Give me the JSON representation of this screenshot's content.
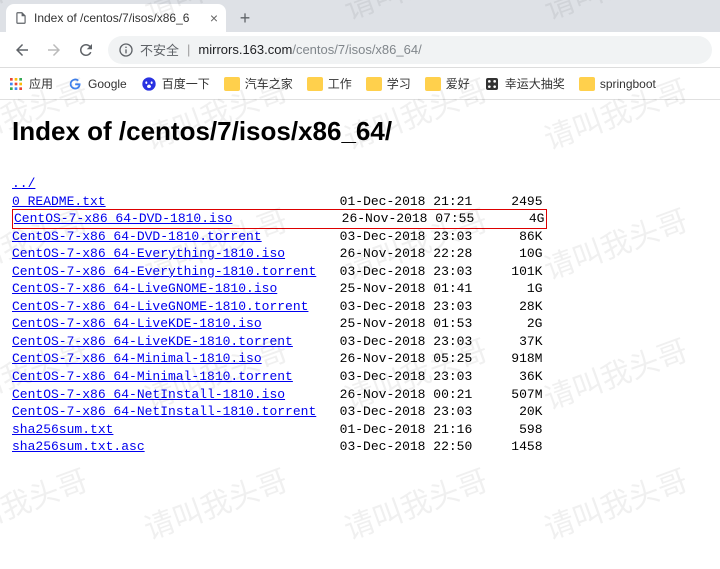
{
  "tab": {
    "title": "Index of /centos/7/isos/x86_6"
  },
  "nav": {
    "warning": "不安全",
    "host": "mirrors.163.com",
    "path": "/centos/7/isos/x86_64/"
  },
  "bookmarks": {
    "apps": "应用",
    "items": [
      {
        "label": "Google",
        "icon": "google"
      },
      {
        "label": "百度一下",
        "icon": "baidu"
      },
      {
        "label": "汽车之家",
        "icon": "folder"
      },
      {
        "label": "工作",
        "icon": "folder"
      },
      {
        "label": "学习",
        "icon": "folder"
      },
      {
        "label": "爱好",
        "icon": "folder"
      },
      {
        "label": "幸运大抽奖",
        "icon": "dice"
      },
      {
        "label": "springboot",
        "icon": "folder"
      }
    ]
  },
  "page": {
    "heading": "Index of /centos/7/isos/x86_64/",
    "parent_link": "../",
    "highlighted_row_index": 1,
    "files": [
      {
        "name": "0_README.txt",
        "date": "01-Dec-2018 21:21",
        "size": "2495"
      },
      {
        "name": "CentOS-7-x86_64-DVD-1810.iso",
        "date": "26-Nov-2018 07:55",
        "size": "4G"
      },
      {
        "name": "CentOS-7-x86_64-DVD-1810.torrent",
        "date": "03-Dec-2018 23:03",
        "size": "86K"
      },
      {
        "name": "CentOS-7-x86_64-Everything-1810.iso",
        "date": "26-Nov-2018 22:28",
        "size": "10G"
      },
      {
        "name": "CentOS-7-x86_64-Everything-1810.torrent",
        "date": "03-Dec-2018 23:03",
        "size": "101K"
      },
      {
        "name": "CentOS-7-x86_64-LiveGNOME-1810.iso",
        "date": "25-Nov-2018 01:41",
        "size": "1G"
      },
      {
        "name": "CentOS-7-x86_64-LiveGNOME-1810.torrent",
        "date": "03-Dec-2018 23:03",
        "size": "28K"
      },
      {
        "name": "CentOS-7-x86_64-LiveKDE-1810.iso",
        "date": "25-Nov-2018 01:53",
        "size": "2G"
      },
      {
        "name": "CentOS-7-x86_64-LiveKDE-1810.torrent",
        "date": "03-Dec-2018 23:03",
        "size": "37K"
      },
      {
        "name": "CentOS-7-x86_64-Minimal-1810.iso",
        "date": "26-Nov-2018 05:25",
        "size": "918M"
      },
      {
        "name": "CentOS-7-x86_64-Minimal-1810.torrent",
        "date": "03-Dec-2018 23:03",
        "size": "36K"
      },
      {
        "name": "CentOS-7-x86_64-NetInstall-1810.iso",
        "date": "26-Nov-2018 00:21",
        "size": "507M"
      },
      {
        "name": "CentOS-7-x86_64-NetInstall-1810.torrent",
        "date": "03-Dec-2018 23:03",
        "size": "20K"
      },
      {
        "name": "sha256sum.txt",
        "date": "01-Dec-2018 21:16",
        "size": "598"
      },
      {
        "name": "sha256sum.txt.asc",
        "date": "03-Dec-2018 22:50",
        "size": "1458"
      }
    ]
  },
  "watermark": "请叫我头哥"
}
